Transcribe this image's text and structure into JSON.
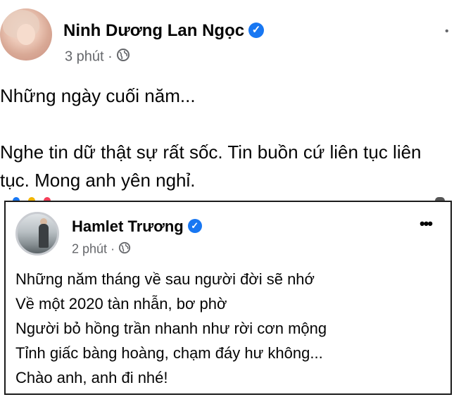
{
  "post1": {
    "author": "Ninh Dương Lan Ngọc",
    "verified_icon": "check-badge-icon",
    "time": "3 phút",
    "separator": "·",
    "audience_icon": "globe-icon",
    "more_icon": "ellipsis-icon",
    "paragraphs": [
      "Những ngày cuối năm...",
      "",
      "Nghe tin dữ thật sự rất sốc. Tin buồn cứ liên tục liên",
      "tục. Mong anh yên nghỉ."
    ]
  },
  "post2": {
    "author": "Hamlet Trương",
    "verified_icon": "check-badge-icon",
    "time": "2 phút",
    "separator": "·",
    "audience_icon": "globe-icon",
    "more_label": "•••",
    "lines": [
      "Những năm tháng về sau người đời sẽ nhớ",
      "Về một 2020 tàn nhẫn, bơ phờ",
      "Người bỏ hồng trần nhanh như rời cơn mộng",
      "Tỉnh giấc bàng hoàng, chạm đáy hư không...",
      "Chào anh, anh đi nhé!"
    ]
  },
  "colors": {
    "verified": "#1877f2",
    "meta_text": "#65676b",
    "body_text": "#050505"
  }
}
